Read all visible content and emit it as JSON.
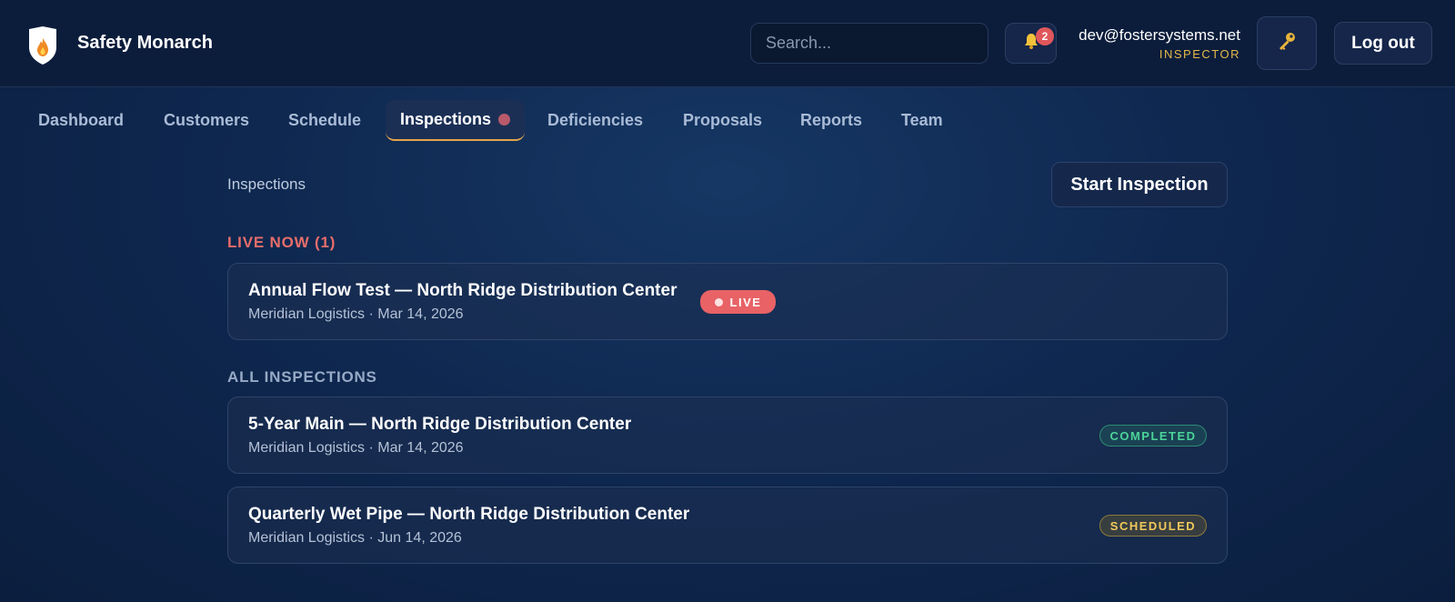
{
  "header": {
    "brand": "Safety Monarch",
    "search_placeholder": "Search...",
    "notifications_count": "2",
    "user_email": "dev@fostersystems.net",
    "user_role": "INSPECTOR",
    "logout_label": "Log out",
    "icons": {
      "logo": "shield-flame-icon",
      "bell": "bell-icon",
      "key": "key-icon"
    }
  },
  "nav": {
    "items": [
      {
        "label": "Dashboard"
      },
      {
        "label": "Customers"
      },
      {
        "label": "Schedule"
      },
      {
        "label": "Inspections",
        "active": true,
        "indicator": "dot"
      },
      {
        "label": "Deficiencies"
      },
      {
        "label": "Proposals"
      },
      {
        "label": "Reports"
      },
      {
        "label": "Team"
      }
    ]
  },
  "main": {
    "breadcrumb": "Inspections",
    "start_button": "Start Inspection",
    "live_section": {
      "label": "LIVE NOW (1)",
      "items": [
        {
          "title": "Annual Flow Test — North Ridge Distribution Center",
          "subtitle": "Meridian Logistics · Mar 14, 2026",
          "badge": "LIVE"
        }
      ]
    },
    "all_section": {
      "label": "ALL INSPECTIONS",
      "items": [
        {
          "title": "5-Year Main — North Ridge Distribution Center",
          "subtitle": "Meridian Logistics · Mar 14, 2026",
          "badge": "COMPLETED"
        },
        {
          "title": "Quarterly Wet Pipe — North Ridge Distribution Center",
          "subtitle": "Meridian Logistics · Jun 14, 2026",
          "badge": "SCHEDULED"
        }
      ]
    }
  },
  "colors": {
    "accent_gold": "#e6b84a",
    "live_red": "#e86266",
    "completed_green": "#4cd39a",
    "scheduled_yellow": "#f0c85a"
  }
}
